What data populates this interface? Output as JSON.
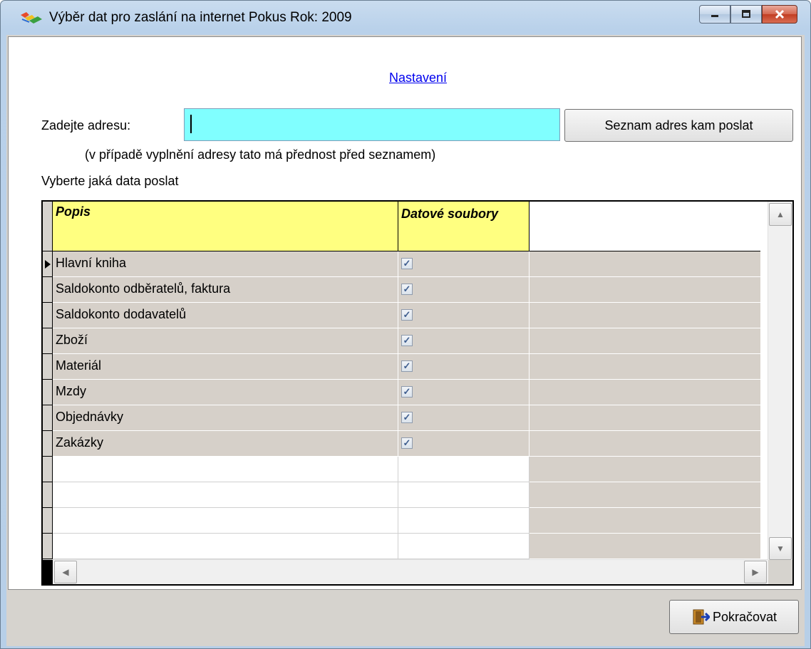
{
  "window": {
    "title": "Výběr dat pro zaslání na internet  Pokus  Rok: 2009",
    "icon": "app-icon"
  },
  "settings_link": "Nastavení",
  "address": {
    "label": "Zadejte adresu:",
    "value": "",
    "hint": "(v případě vyplnění adresy tato má přednost před seznamem)",
    "list_button": "Seznam adres kam poslat"
  },
  "select_label": "Vyberte jaká data poslat",
  "grid": {
    "columns": [
      "Popis",
      "Datové soubory"
    ],
    "rows": [
      {
        "popis": "Hlavní kniha",
        "checked": true
      },
      {
        "popis": "Saldokonto odběratelů, faktura",
        "checked": true
      },
      {
        "popis": "Saldokonto dodavatelů",
        "checked": true
      },
      {
        "popis": "Zboží",
        "checked": true
      },
      {
        "popis": "Materiál",
        "checked": true
      },
      {
        "popis": "Mzdy",
        "checked": true
      },
      {
        "popis": "Objednávky",
        "checked": true
      },
      {
        "popis": "Zakázky",
        "checked": true
      }
    ],
    "empty_rows": 4
  },
  "continue_button": "Pokračovat",
  "colors": {
    "input_bg": "#80ffff",
    "header_bg": "#ffff80",
    "row_bg": "#d6d0c9",
    "link": "#0000ee"
  }
}
